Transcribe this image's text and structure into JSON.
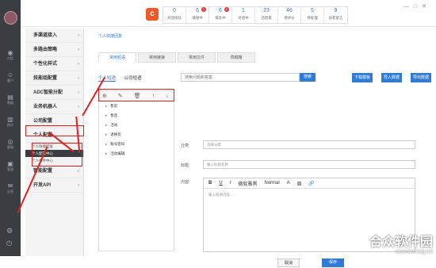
{
  "rail": {
    "items": [
      "对话",
      "客户",
      "数据",
      "统计",
      "客服",
      "管理",
      "分享",
      "设置"
    ]
  },
  "stats": [
    {
      "n": "0",
      "l": "对话排队"
    },
    {
      "n": "6",
      "l": "请接中",
      "badge": "1"
    },
    {
      "n": "6",
      "l": "排队中",
      "badge": "0"
    },
    {
      "n": "1",
      "l": "对话中"
    },
    {
      "n": "23",
      "l": "已结束"
    },
    {
      "n": "46",
      "l": "待评价"
    },
    {
      "n": "5",
      "l": "待处理"
    },
    {
      "n": "9",
      "l": "访客留言"
    }
  ],
  "sidebar": {
    "items": [
      {
        "label": "多渠道接入"
      },
      {
        "label": "多路由策略"
      },
      {
        "label": "个性化样式"
      },
      {
        "label": "技能组配置"
      },
      {
        "label": "ADC智能分配"
      },
      {
        "label": "业务机器人"
      },
      {
        "label": "公司配置"
      },
      {
        "label": "个人配置"
      }
    ],
    "subs": [
      "个人快捷回复",
      "个人配置中心",
      "个人事件中心"
    ],
    "after": [
      {
        "label": "智能配置"
      },
      {
        "label": "开发API"
      }
    ]
  },
  "crumb": "个人快捷回复",
  "tabs": [
    "常用短语",
    "常用链接",
    "常用文件",
    "草稿箱"
  ],
  "subtabs": [
    "个人短语",
    "公司短语"
  ],
  "search": {
    "placeholder": "搜索问题和答案",
    "btn": "搜索"
  },
  "rbtns": [
    "下载模板",
    "导入数据",
    "导出数据"
  ],
  "tree": [
    "售前",
    "售后",
    "活动",
    "退换货",
    "账号密码",
    "活动编辑"
  ],
  "form": {
    "cat_label": "分类:",
    "cat_ph": "选择分类",
    "title_label": "标题:",
    "title_ph": "输入标题名称",
    "content_label": "内容:",
    "font": "微软雅黑",
    "size": "Normal",
    "editor_ph": "输入短语内容...",
    "cancel": "取消",
    "save": "保存"
  },
  "watermark": {
    "big": "合众软件园",
    "small": "www.hezhong.net"
  }
}
